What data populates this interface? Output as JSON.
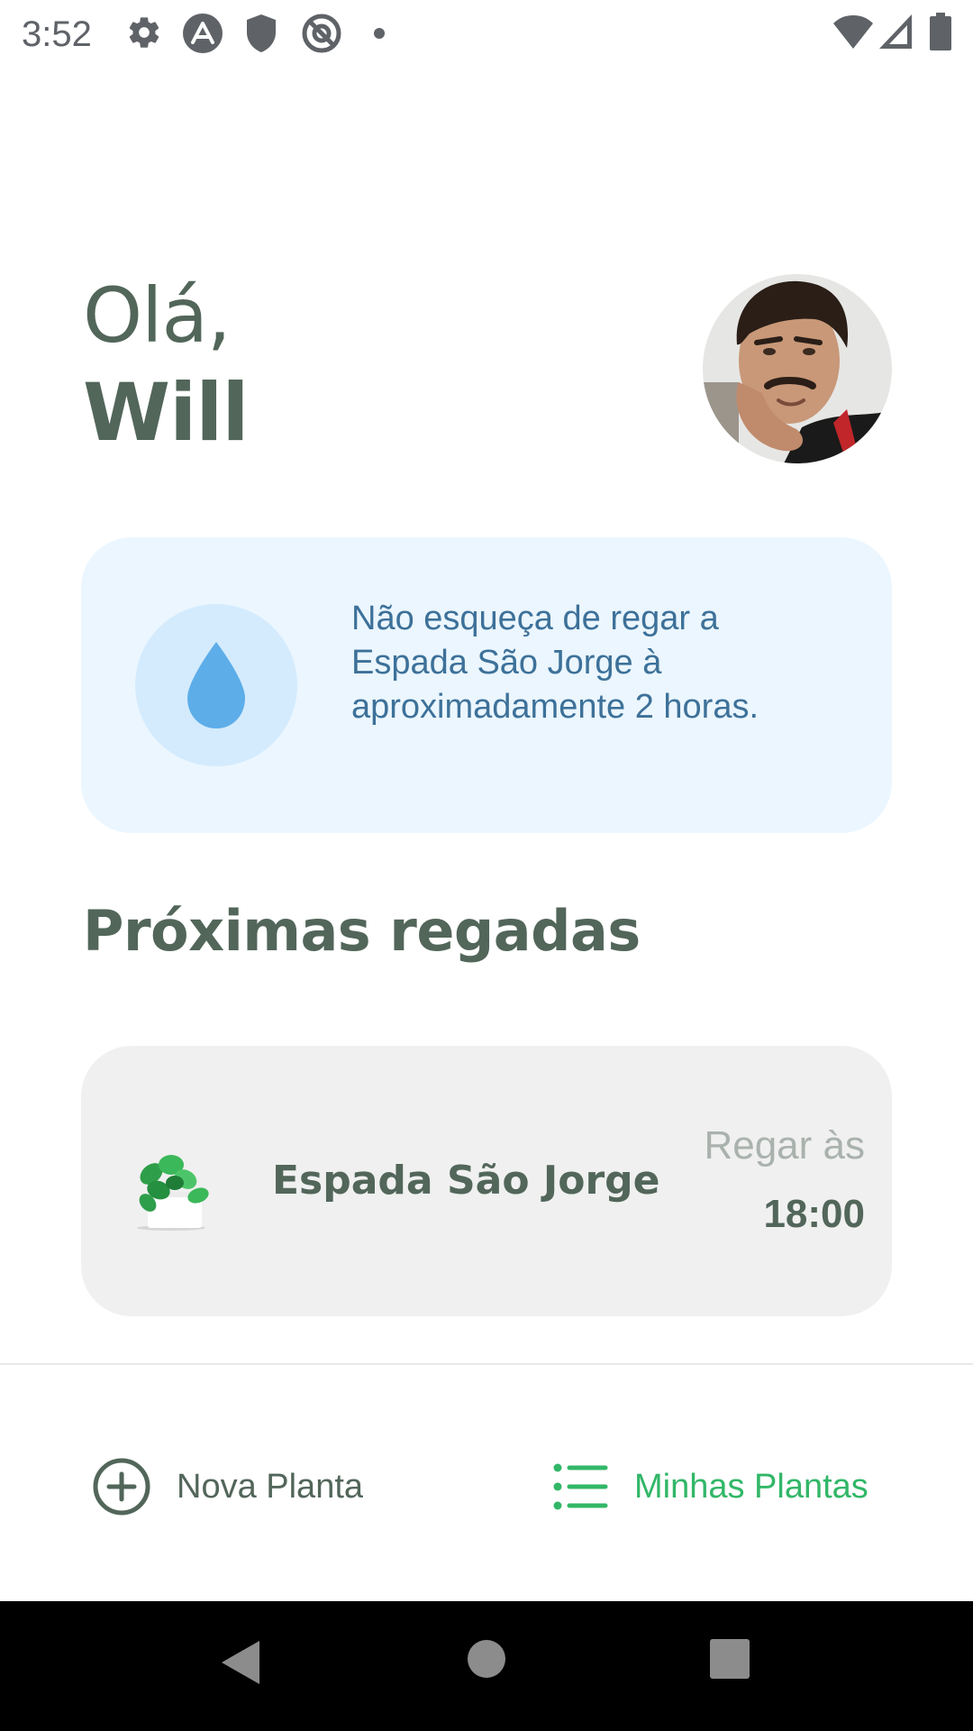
{
  "status_bar": {
    "time": "3:52",
    "icons": [
      "gear-icon",
      "expo-icon",
      "shield-icon",
      "at-sign-icon",
      "dot-icon",
      "wifi-icon",
      "signal-icon",
      "battery-icon"
    ]
  },
  "greeting": {
    "hello": "Olá,",
    "name": "Will"
  },
  "tip": {
    "icon": "water-drop-icon",
    "text": "Não esqueça de regar a Espada São Jorge à aproximadamente 2 horas."
  },
  "section": {
    "title": "Próximas regadas"
  },
  "plants": [
    {
      "name": "Espada São Jorge",
      "time_label": "Regar às",
      "time": "18:00"
    }
  ],
  "tabs": [
    {
      "label": "Nova Planta",
      "icon": "plus-circle-icon",
      "active": false
    },
    {
      "label": "Minhas Plantas",
      "icon": "list-icon",
      "active": true
    }
  ],
  "colors": {
    "heading": "#52665a",
    "accent_green": "#32b768",
    "tip_background": "#ebf6ff",
    "tip_text": "#3d7199",
    "card_background": "#f0f0f0"
  }
}
